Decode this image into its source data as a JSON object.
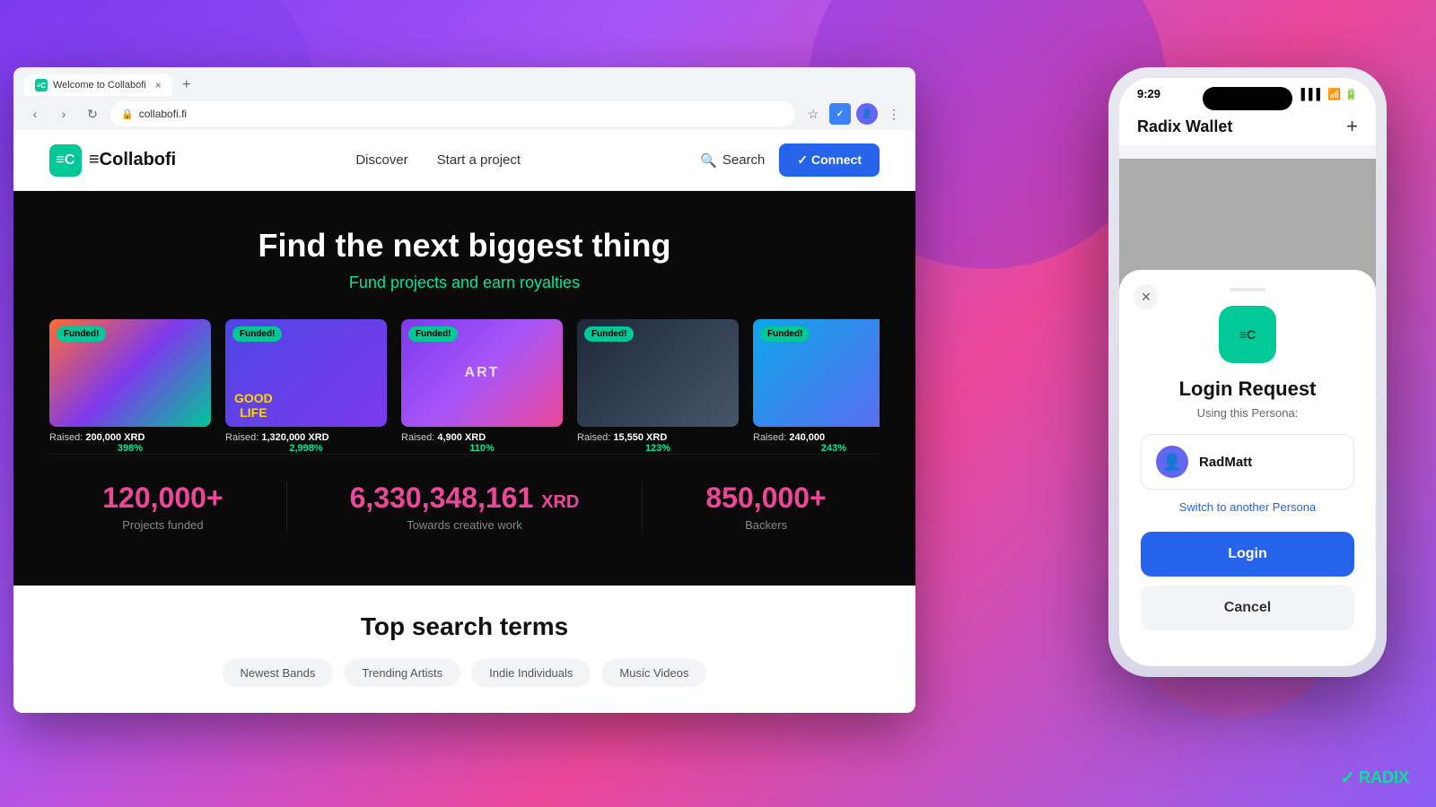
{
  "browser": {
    "tab_title": "Welcome to Collabofi",
    "tab_favicon": "≡C",
    "url": "collabofi.fi",
    "close_symbol": "×",
    "new_tab_symbol": "+",
    "back_symbol": "‹",
    "forward_symbol": "›",
    "refresh_symbol": "↻",
    "star_symbol": "☆"
  },
  "site": {
    "logo_text": "≡Collabofi",
    "logo_icon": "≡C",
    "nav": {
      "discover": "Discover",
      "start_project": "Start a project"
    },
    "search_label": "Search",
    "connect_label": "✓ Connect"
  },
  "hero": {
    "title": "Find the next biggest thing",
    "subtitle": "Fund projects and earn royalties"
  },
  "projects": [
    {
      "id": 1,
      "funded_badge": "Funded!",
      "raised_label": "Raised:",
      "raised_amount": "200,000 XRD",
      "percent": "398%",
      "image_class": "project-image-1"
    },
    {
      "id": 2,
      "funded_badge": "Funded!",
      "raised_label": "Raised:",
      "raised_amount": "1,320,000 XRD",
      "percent": "2,998%",
      "image_class": "project-image-2",
      "image_text": "GOOD\nLIFE"
    },
    {
      "id": 3,
      "funded_badge": "Funded!",
      "raised_label": "Raised:",
      "raised_amount": "4,900 XRD",
      "percent": "110%",
      "image_class": "project-image-3",
      "image_text": "ART"
    },
    {
      "id": 4,
      "funded_badge": "Funded!",
      "raised_label": "Raised:",
      "raised_amount": "15,550 XRD",
      "percent": "123%",
      "image_class": "project-image-4"
    },
    {
      "id": 5,
      "funded_badge": "Funded!",
      "raised_label": "Raised:",
      "raised_amount": "240,000",
      "percent": "243%",
      "image_class": "project-image-5"
    }
  ],
  "stats": [
    {
      "number": "120,000+",
      "label": "Projects funded"
    },
    {
      "number": "6,330,348,161",
      "suffix": " XRD",
      "label": "Towards creative work"
    },
    {
      "number": "850,000+",
      "label": "Backers"
    }
  ],
  "bottom": {
    "section_title": "Top search terms",
    "tags": [
      "Newest Bands",
      "Trending Artists",
      "Indie Individuals",
      "Music Videos"
    ]
  },
  "phone": {
    "status_time": "9:29",
    "signal": "▌▌▌",
    "wifi": "WiFi",
    "battery": "▮▮▮",
    "wallet_title": "Radix Wallet",
    "wallet_plus": "+",
    "modal": {
      "app_icon": "≡C",
      "title": "Login Request",
      "subtitle": "Using this Persona:",
      "persona_name": "RadMatt",
      "switch_persona": "Switch to another Persona",
      "login_label": "Login",
      "cancel_label": "Cancel"
    }
  },
  "radix_logo": {
    "check": "✓",
    "text": "RADIX"
  }
}
